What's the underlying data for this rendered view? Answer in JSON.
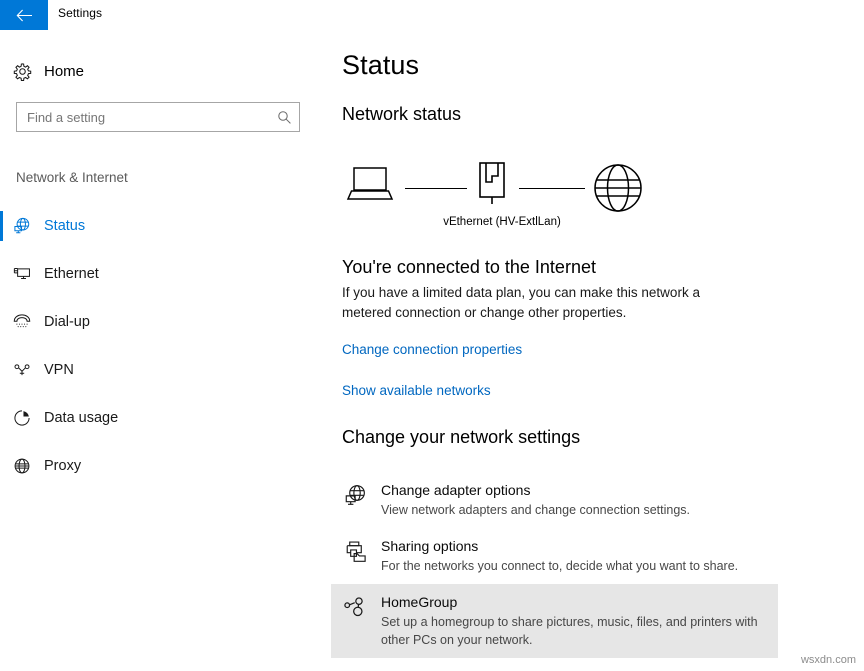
{
  "titlebar": {
    "back_icon": "back-arrow-icon",
    "back_accent": "#0078d7",
    "title": "Settings"
  },
  "sidebar": {
    "home": {
      "label": "Home",
      "icon": "gear-icon"
    },
    "search": {
      "placeholder": "Find a setting",
      "value": "",
      "icon": "search-icon"
    },
    "group_title": "Network & Internet",
    "accent_color": "#0078d7",
    "items": [
      {
        "label": "Status",
        "icon": "globe-monitor-icon",
        "active": true
      },
      {
        "label": "Ethernet",
        "icon": "ethernet-monitor-icon",
        "active": false
      },
      {
        "label": "Dial-up",
        "icon": "phone-handset-icon",
        "active": false
      },
      {
        "label": "VPN",
        "icon": "vpn-key-icon",
        "active": false
      },
      {
        "label": "Data usage",
        "icon": "pie-chart-icon",
        "active": false
      },
      {
        "label": "Proxy",
        "icon": "globe-icon",
        "active": false
      }
    ]
  },
  "main": {
    "page_title": "Status",
    "network_status_heading": "Network status",
    "diagram": {
      "device_icon": "laptop-icon",
      "adapter_icon": "ethernet-port-icon",
      "internet_icon": "globe-icon",
      "network_label": "vEthernet (HV-ExtlLan)"
    },
    "connected_title": "You're connected to the Internet",
    "connected_desc": "If you have a limited data plan, you can make this network a metered connection or change other properties.",
    "links": [
      {
        "label": "Change connection properties"
      },
      {
        "label": "Show available networks"
      }
    ],
    "change_settings_heading": "Change your network settings",
    "settings": [
      {
        "title": "Change adapter options",
        "desc": "View network adapters and change connection settings.",
        "icon": "globe-monitor-icon",
        "highlighted": false
      },
      {
        "title": "Sharing options",
        "desc": "For the networks you connect to, decide what you want to share.",
        "icon": "printer-folder-icon",
        "highlighted": false
      },
      {
        "title": "HomeGroup",
        "desc": "Set up a homegroup to share pictures, music, files, and printers with other PCs on your network.",
        "icon": "nodes-icon",
        "highlighted": true,
        "highlight_color": "#e6e6e6"
      }
    ]
  },
  "watermark": "wsxdn.com"
}
